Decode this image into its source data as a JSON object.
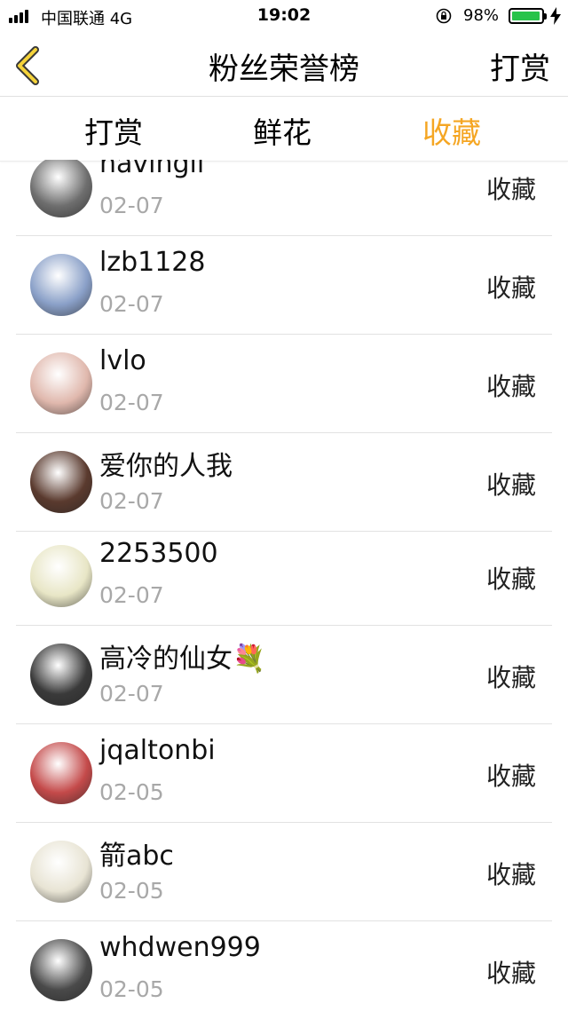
{
  "status_bar": {
    "carrier": "中国联通  4G",
    "time": "19:02",
    "battery": "98%",
    "battery_level": 0.98,
    "battery_color": "#27c34a"
  },
  "nav": {
    "title": "粉丝荣誉榜",
    "right_button": "打赏",
    "back_icon": "chevron-left-icon"
  },
  "tabs": [
    {
      "label": "打赏",
      "active": false
    },
    {
      "label": "鲜花",
      "active": false
    },
    {
      "label": "收藏",
      "active": true
    }
  ],
  "accent_color": "#f5a623",
  "rows": [
    {
      "name": "havingli",
      "date": "02-07",
      "action": "收藏",
      "avatar_color": "#6e6e6e"
    },
    {
      "name": "lzb1128",
      "date": "02-07",
      "action": "收藏",
      "avatar_color": "#8aa0c8"
    },
    {
      "name": "lvlo",
      "date": "02-07",
      "action": "收藏",
      "avatar_color": "#e0b8ad"
    },
    {
      "name": "爱你的人我",
      "date": "02-07",
      "action": "收藏",
      "avatar_color": "#5a3a2e"
    },
    {
      "name": "2253500",
      "date": "02-07",
      "action": "收藏",
      "avatar_color": "#e8e6c6"
    },
    {
      "name": "高冷的仙女💐",
      "date": "02-07",
      "action": "收藏",
      "avatar_color": "#3a3a3a"
    },
    {
      "name": "jqaltonbi",
      "date": "02-05",
      "action": "收藏",
      "avatar_color": "#c44a4a"
    },
    {
      "name": "箭abc",
      "date": "02-05",
      "action": "收藏",
      "avatar_color": "#e8e4d4"
    },
    {
      "name": "whdwen999",
      "date": "02-05",
      "action": "收藏",
      "avatar_color": "#4a4a4a"
    }
  ]
}
